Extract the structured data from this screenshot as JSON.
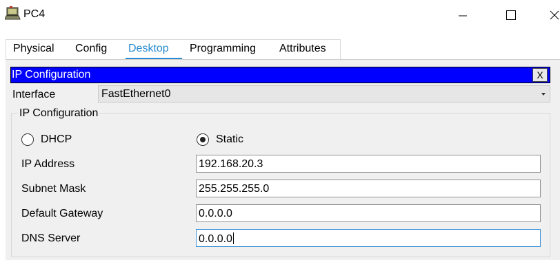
{
  "window": {
    "title": "PC4",
    "icon": "pc-computer-icon",
    "controls": {
      "minimize": "minimize-icon",
      "maximize": "maximize-icon",
      "close": "close-icon"
    }
  },
  "tabs": [
    {
      "label": "Physical",
      "active": false
    },
    {
      "label": "Config",
      "active": false
    },
    {
      "label": "Desktop",
      "active": true
    },
    {
      "label": "Programming",
      "active": false
    },
    {
      "label": "Attributes",
      "active": false
    }
  ],
  "ip_config": {
    "header_title": "IP Configuration",
    "close_label": "X",
    "interface_label": "Interface",
    "interface_value": "FastEthernet0",
    "group_title": "IP Configuration",
    "mode": {
      "dhcp_label": "DHCP",
      "static_label": "Static",
      "selected": "Static"
    },
    "fields": {
      "ip_address": {
        "label": "IP Address",
        "value": "192.168.20.3"
      },
      "subnet_mask": {
        "label": "Subnet Mask",
        "value": "255.255.255.0"
      },
      "default_gateway": {
        "label": "Default Gateway",
        "value": "0.0.0.0"
      },
      "dns_server": {
        "label": "DNS Server",
        "value": "0.0.0.0"
      }
    }
  },
  "colors": {
    "accent": "#2a8bd0",
    "header_bg": "#0000ff",
    "panel_bg": "#f0f0f0"
  }
}
